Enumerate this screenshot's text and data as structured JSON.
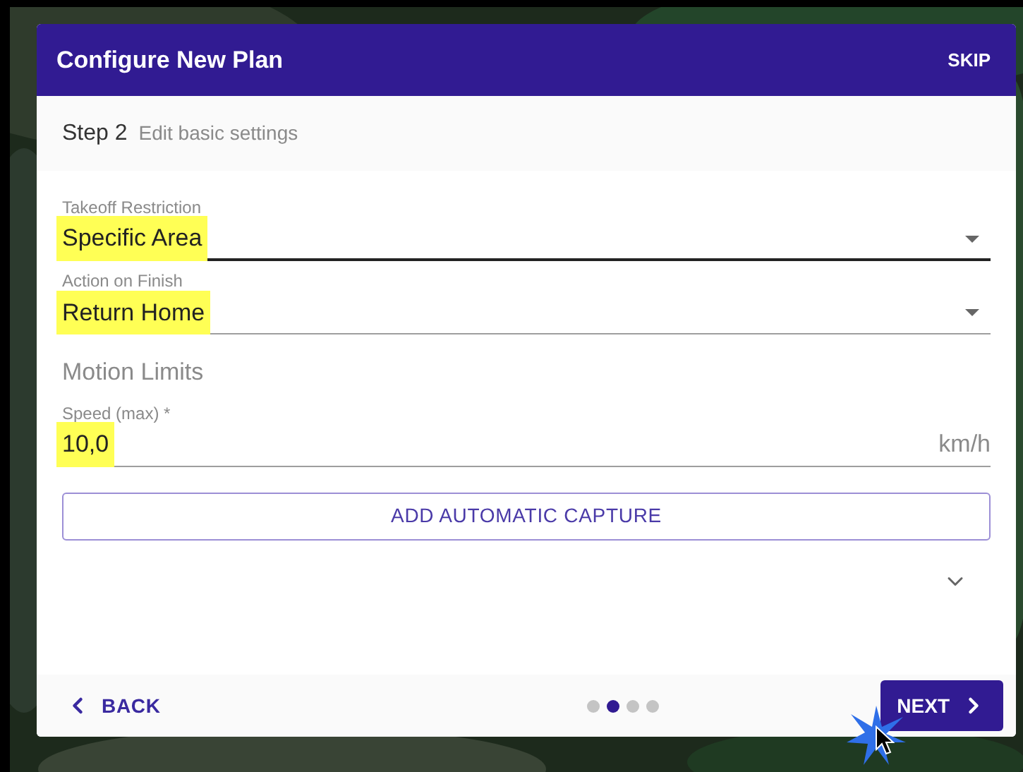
{
  "dialog": {
    "title": "Configure New Plan",
    "skip": "SKIP"
  },
  "step": {
    "number": "Step 2",
    "description": "Edit basic settings"
  },
  "fields": [
    {
      "kind": "select",
      "label": "Takeoff Restriction",
      "value": "Specific Area",
      "highlighted": true,
      "focused": true
    },
    {
      "kind": "select",
      "label": "Action on Finish",
      "value": "Return Home",
      "highlighted": true,
      "focused": false
    },
    {
      "kind": "heading",
      "label": "Motion Limits"
    },
    {
      "kind": "number",
      "label": "Speed (max) *",
      "value": "10,0",
      "unit": "km/h",
      "highlighted": true,
      "focused": false
    }
  ],
  "capture_button": "ADD AUTOMATIC CAPTURE",
  "footer": {
    "back": "BACK",
    "next": "NEXT",
    "steps": [
      {
        "selected": false
      },
      {
        "selected": true
      },
      {
        "selected": false
      },
      {
        "selected": false
      }
    ]
  }
}
